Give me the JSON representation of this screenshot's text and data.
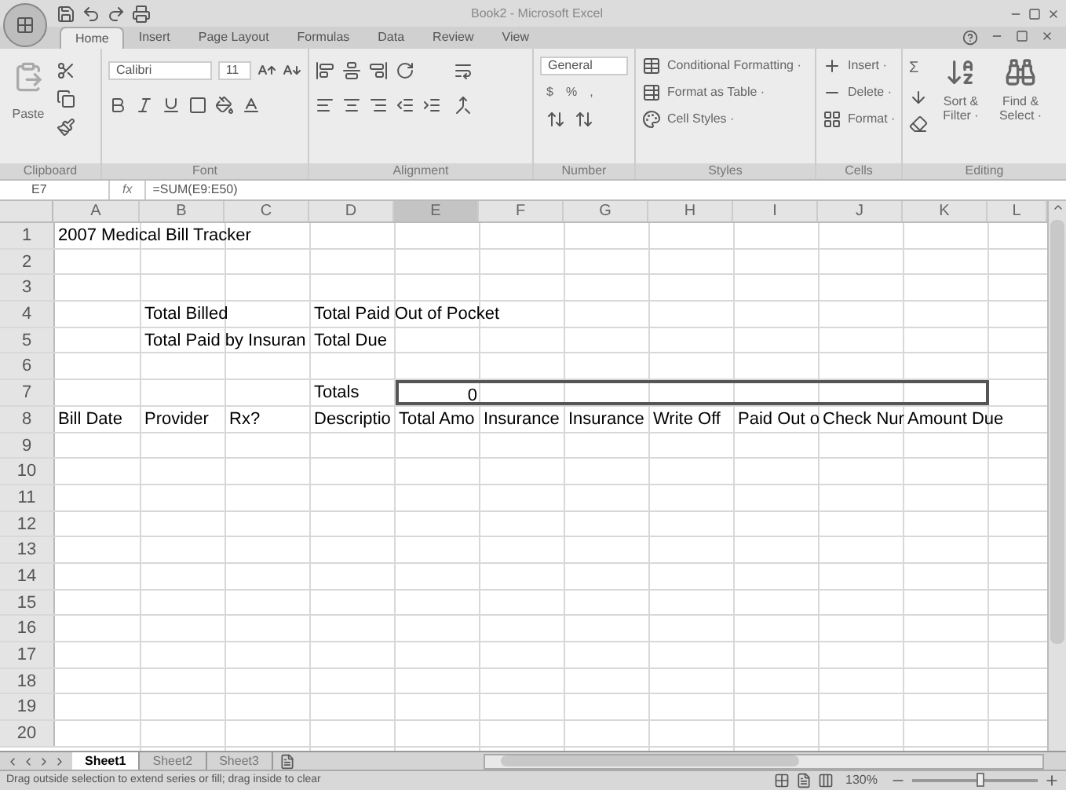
{
  "window": {
    "title": "Book2 - Microsoft Excel"
  },
  "tabs": [
    {
      "label": "Home",
      "selected": true
    },
    {
      "label": "Insert",
      "selected": false
    },
    {
      "label": "Page Layout",
      "selected": false
    },
    {
      "label": "Formulas",
      "selected": false
    },
    {
      "label": "Data",
      "selected": false
    },
    {
      "label": "Review",
      "selected": false
    },
    {
      "label": "View",
      "selected": false
    }
  ],
  "ribbon": {
    "clipboard": {
      "label": "Clipboard",
      "paste": "Paste"
    },
    "font": {
      "label": "Font",
      "name": "Calibri",
      "size": "11"
    },
    "alignment": {
      "label": "Alignment"
    },
    "number": {
      "label": "Number",
      "format": "General",
      "currency": "$",
      "percent": "%",
      "comma": ","
    },
    "styles": {
      "label": "Styles",
      "items": [
        "Conditional Formatting ·",
        "Format as Table ·",
        "Cell Styles ·"
      ]
    },
    "cells": {
      "label": "Cells",
      "items": [
        "Insert ·",
        "Delete ·",
        "Format ·"
      ]
    },
    "editing": {
      "label": "Editing",
      "sum": "Σ",
      "sort": "Sort & Filter ·",
      "find": "Find & Select ·"
    }
  },
  "formula_bar": {
    "name_box": "E7",
    "fx": "fx",
    "formula": "=SUM(E9:E50)"
  },
  "columns": [
    {
      "label": "A",
      "selected": false
    },
    {
      "label": "B",
      "selected": false
    },
    {
      "label": "C",
      "selected": false
    },
    {
      "label": "D",
      "selected": false
    },
    {
      "label": "E",
      "selected": true
    },
    {
      "label": "F",
      "selected": false
    },
    {
      "label": "G",
      "selected": false
    },
    {
      "label": "H",
      "selected": false
    },
    {
      "label": "I",
      "selected": false
    },
    {
      "label": "J",
      "selected": false
    },
    {
      "label": "K",
      "selected": false
    },
    {
      "label": "L",
      "selected": false
    }
  ],
  "rows": [
    {
      "number": "1",
      "cells": [
        {
          "text": "2007 Medical Bill Tracker"
        }
      ]
    },
    {
      "number": "2",
      "cells": []
    },
    {
      "number": "3",
      "cells": []
    },
    {
      "number": "4",
      "cells": [
        {},
        {
          "text": "Total Billed"
        },
        {},
        {
          "text": "Total Paid Out of Pocket"
        }
      ]
    },
    {
      "number": "5",
      "cells": [
        {},
        {
          "text": "Total Paid by Insuran"
        },
        {},
        {
          "text": "Total Due"
        }
      ]
    },
    {
      "number": "6",
      "cells": []
    },
    {
      "number": "7",
      "cells": [
        {},
        {},
        {},
        {
          "text": "Totals"
        },
        {
          "text": "0",
          "kind": "number",
          "selected": true
        },
        {
          "selected": true
        },
        {
          "selected": true
        },
        {
          "selected": true
        },
        {
          "selected": true
        },
        {
          "selected": true
        },
        {
          "selected": true
        }
      ]
    },
    {
      "number": "8",
      "cells": [
        {
          "text": "Bill Date"
        },
        {
          "text": "Provider"
        },
        {
          "text": "Rx?"
        },
        {
          "text": "Descriptio"
        },
        {
          "text": "Total Amo"
        },
        {
          "text": "Insurance"
        },
        {
          "text": "Insurance"
        },
        {
          "text": "Write Off"
        },
        {
          "text": "Paid Out o"
        },
        {
          "text": "Check Nur"
        },
        {
          "text": "Amount Due"
        }
      ]
    },
    {
      "number": "9",
      "cells": []
    },
    {
      "number": "10",
      "cells": []
    },
    {
      "number": "11",
      "cells": []
    },
    {
      "number": "12",
      "cells": []
    },
    {
      "number": "13",
      "cells": []
    },
    {
      "number": "14",
      "cells": []
    },
    {
      "number": "15",
      "cells": []
    },
    {
      "number": "16",
      "cells": []
    },
    {
      "number": "17",
      "cells": []
    },
    {
      "number": "18",
      "cells": []
    },
    {
      "number": "19",
      "cells": []
    },
    {
      "number": "20",
      "cells": []
    }
  ],
  "sheet_tabs": [
    {
      "label": "Sheet1",
      "selected": true
    },
    {
      "label": "Sheet2",
      "selected": false
    },
    {
      "label": "Sheet3",
      "selected": false
    }
  ],
  "status_bar": {
    "message": "Drag outside selection to extend series or fill; drag inside to clear",
    "zoom": "130%",
    "zoom_slider": {
      "level": 0.55
    }
  }
}
